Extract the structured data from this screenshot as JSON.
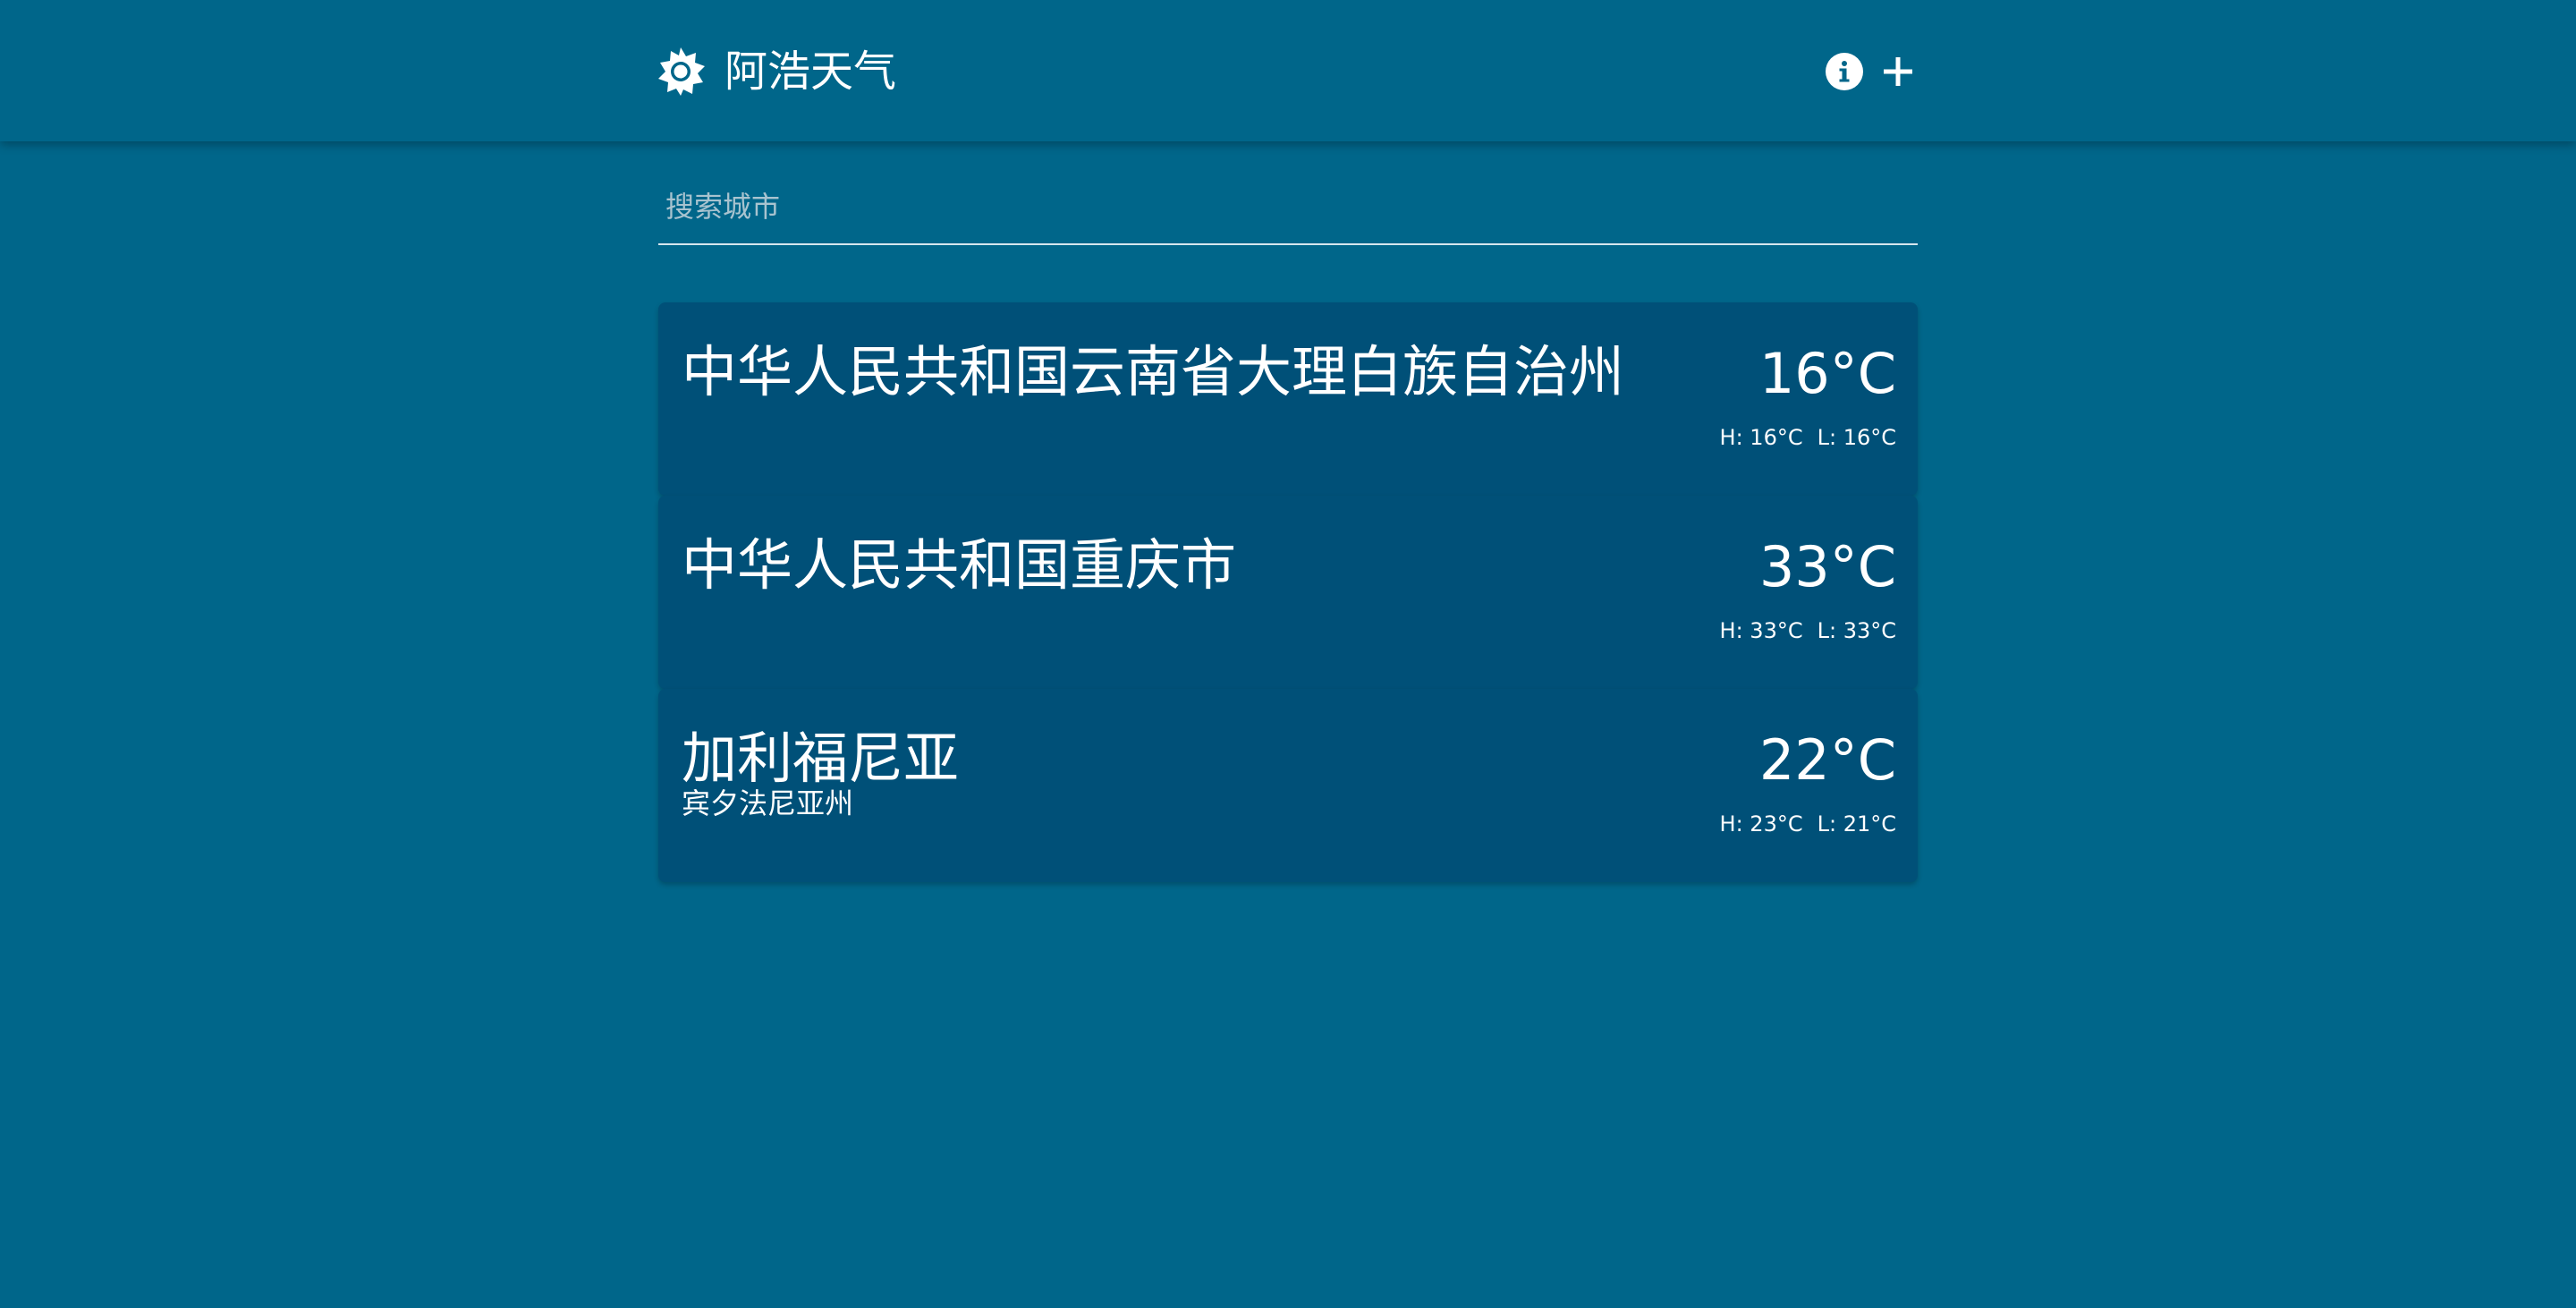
{
  "app": {
    "title": "阿浩天气",
    "logo_icon": "sun-icon",
    "info_icon": "info-icon",
    "add_icon": "plus-icon"
  },
  "search": {
    "placeholder": "搜索城市",
    "value": ""
  },
  "colors": {
    "background": "#00668a",
    "card": "#005078",
    "text": "#ffffff"
  },
  "cities": [
    {
      "name": "中华人民共和国云南省大理白族自治州",
      "subtitle": "",
      "temp": "16°C",
      "high": "H: 16°C",
      "low": "L: 16°C"
    },
    {
      "name": "中华人民共和国重庆市",
      "subtitle": "",
      "temp": "33°C",
      "high": "H: 33°C",
      "low": "L: 33°C"
    },
    {
      "name": "加利福尼亚",
      "subtitle": "宾夕法尼亚州",
      "temp": "22°C",
      "high": "H: 23°C",
      "low": "L: 21°C"
    }
  ]
}
